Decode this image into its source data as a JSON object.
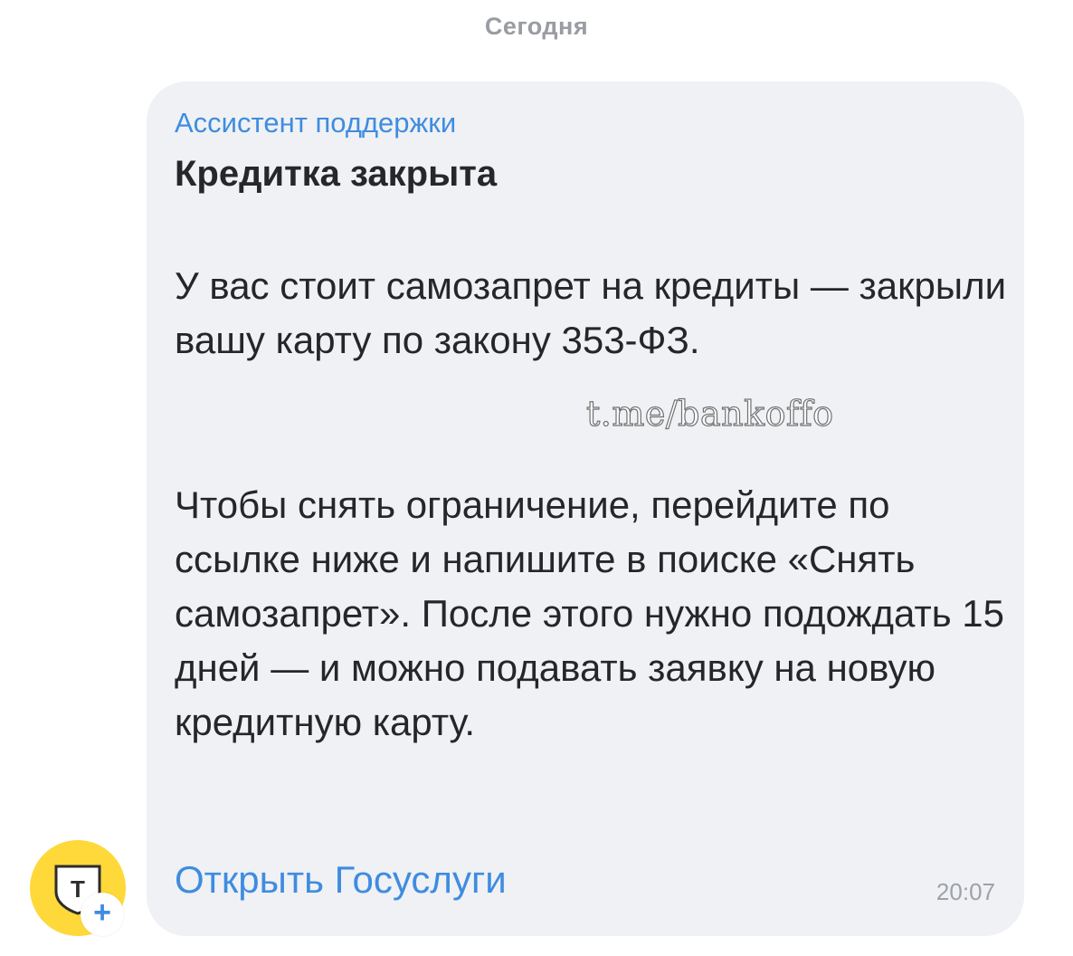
{
  "date_separator": "Сегодня",
  "message": {
    "sender": "Ассистент поддержки",
    "title": "Кредитка закрыта",
    "paragraph_1": "У вас стоит самозапрет на кредиты — закрыли вашу карту по закону 353-ФЗ.",
    "paragraph_2": "Чтобы снять ограничение, перейдите по ссылке ниже и напишите в поиске «Снять самозапрет». После этого нужно подождать 15 дней — и можно подавать заявку на новую кредитную карту.",
    "link_label": "Открыть Госуслуги",
    "time": "20:07"
  },
  "watermark": "t.me/bankoffo",
  "avatar": {
    "letter": "Т",
    "badge": "+",
    "color": "#ffd83a"
  },
  "colors": {
    "accent": "#3f8ce0",
    "bubble": "#eff1f4"
  }
}
